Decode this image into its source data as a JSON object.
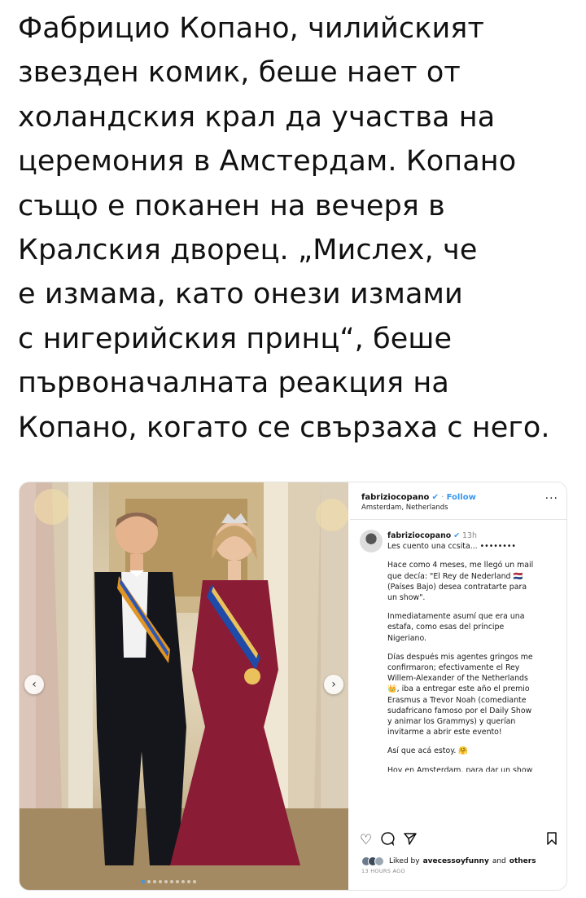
{
  "post": {
    "lines": [
      "Фабрицио Копано, чилийският",
      "звезден комик, беше нает от",
      "холандския крал да участва на",
      "церемония в Амстердам. Копано",
      "също е поканен на вечеря в",
      "Кралския дворец. „Мислех, че",
      "е измама, като онези измами",
      "с нигерийския принц“, беше",
      "първоначалната реакция на",
      "Копано, когато се свързаха с него."
    ]
  },
  "instagram": {
    "username": "fabriziocopano",
    "follow_label": "Follow",
    "location": "Amsterdam, Netherlands",
    "more_icon": "more-icon",
    "caption_time": "13h",
    "caption_first": "Les cuento una ccsita... ••••••••",
    "paragraphs": [
      [
        "Hace como 4 meses, me llegó un mail",
        "que decía: \"El Rey de Nederland 🇳🇱",
        "(Países Bajo) desea contratarte para",
        "un show\"."
      ],
      [
        "Inmediatamente asumí que era una",
        "estafa, como esas del príncipe",
        "Nigeriano."
      ],
      [
        "Días después mis agentes gringos me",
        "confirmaron; efectivamente el Rey",
        "Willem-Alexander of the Netherlands",
        "👑, iba a entregar este año el premio",
        "Erasmus a Trevor Noah (comediante",
        "sudafricano famoso por el Daily Show",
        "y animar los Grammys) y querían",
        "invitarme a abrir este evento!"
      ],
      [
        "Así que acá estoy. 🤗"
      ],
      [
        "Hoy en Amsterdam, para dar un show"
      ]
    ],
    "liked_by_prefix": "Liked by",
    "liked_by_user": "avecessoyfunny",
    "liked_by_suffix": "and",
    "liked_by_others": "others",
    "time_ago": "13 HOURS AGO",
    "colors": {
      "accent": "#3897f0"
    }
  }
}
